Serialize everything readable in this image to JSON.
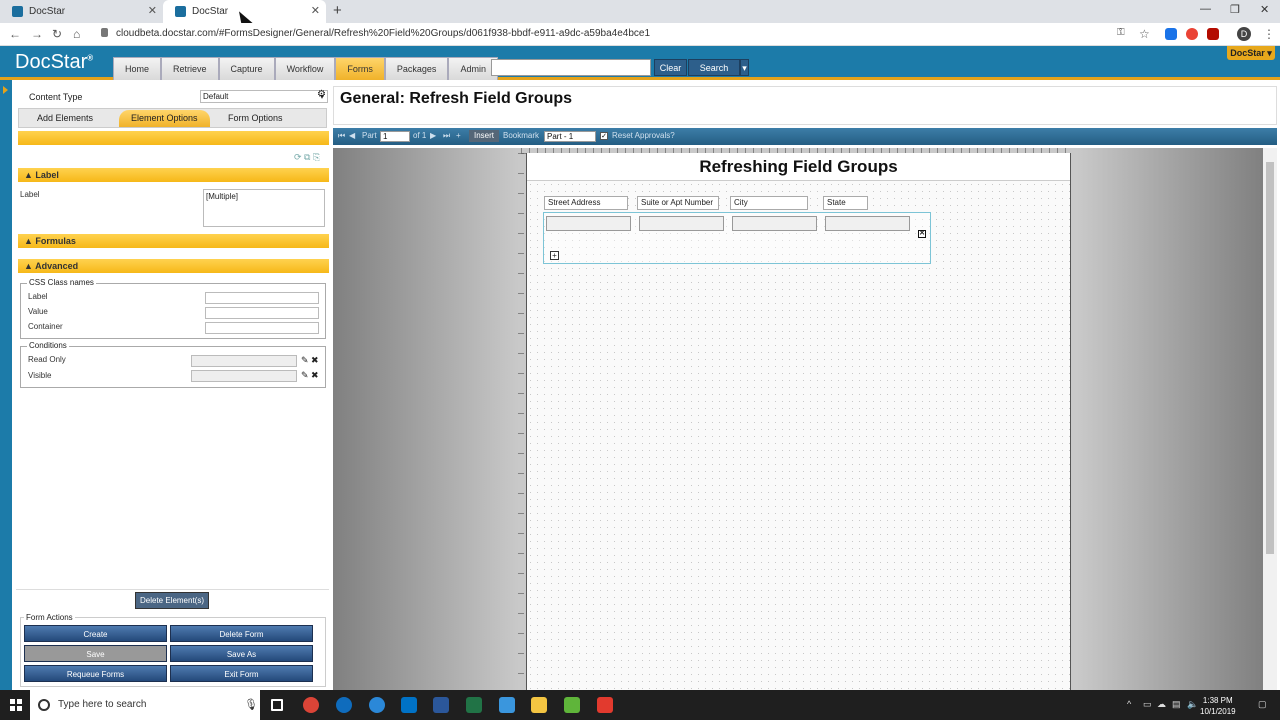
{
  "browser": {
    "tabs": [
      {
        "title": "DocStar"
      },
      {
        "title": "DocStar"
      }
    ],
    "url": "cloudbeta.docstar.com/#FormsDesigner/General/Refresh%20Field%20Groups/d061f938-bbdf-e911-a9dc-a59ba4e4bce1",
    "profile_initial": "D"
  },
  "app": {
    "logo": "DocStar",
    "nav": [
      "Home",
      "Retrieve",
      "Capture",
      "Workflow",
      "Forms",
      "Packages",
      "Admin"
    ],
    "clear_label": "Clear",
    "search_label": "Search",
    "user_badge": "DocStar ▾"
  },
  "left": {
    "content_type_label": "Content Type",
    "content_type_value": "Default",
    "tabs": [
      "Add Elements",
      "Element Options",
      "Form Options"
    ],
    "label_section": "Label",
    "label_field": "Label",
    "label_value": "[Multiple]",
    "formulas_section": "Formulas",
    "advanced_section": "Advanced",
    "css_legend": "CSS Class names",
    "css_fields": [
      "Label",
      "Value",
      "Container"
    ],
    "conditions_legend": "Conditions",
    "conditions": [
      "Read Only",
      "Visible"
    ],
    "delete_label": "Delete Element(s)",
    "form_actions_legend": "Form Actions",
    "actions": [
      "Create",
      "Delete Form",
      "Save",
      "Save As",
      "Requeue Forms",
      "Exit Form"
    ]
  },
  "main": {
    "page_title": "General: Refresh Field Groups",
    "toolbar": {
      "part_label": "Part",
      "part_value": "1",
      "of_label": "of 1",
      "insert_label": "Insert",
      "bookmark_label": "Bookmark",
      "bookmark_value": "Part - 1",
      "reset_label": "Reset Approvals?"
    },
    "form": {
      "title": "Refreshing Field Groups",
      "columns": [
        "Street Address",
        "Suite or Apt Number",
        "City",
        "State"
      ]
    }
  },
  "taskbar": {
    "search_placeholder": "Type here to search",
    "time": "1:38 PM",
    "date": "10/1/2019"
  },
  "colors": {
    "brand_blue": "#1c7ba9",
    "accent_gold": "#f0b22a"
  }
}
